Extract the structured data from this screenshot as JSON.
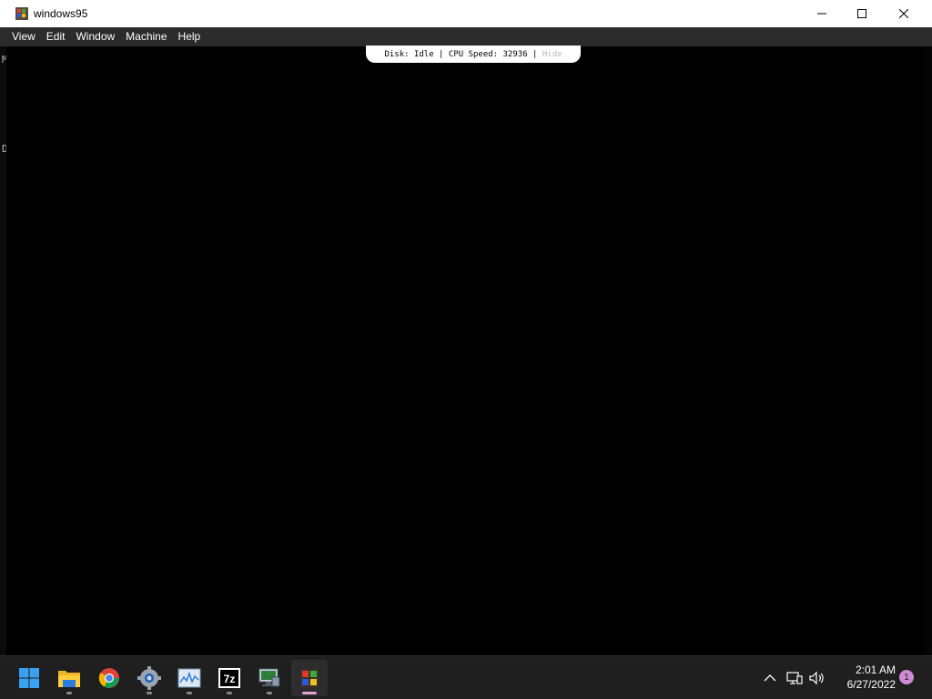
{
  "window": {
    "title": "windows95",
    "app_icon": "windows95-app-icon",
    "controls": {
      "minimize": "minimize-icon",
      "maximize": "maximize-icon",
      "close": "close-icon"
    }
  },
  "menubar": {
    "items": [
      "View",
      "Edit",
      "Window",
      "Machine",
      "Help"
    ]
  },
  "vm": {
    "edge_chars": [
      "M",
      "D"
    ],
    "status": {
      "disk_label": "Disk:",
      "disk_value": "Idle",
      "cpu_label": "CPU Speed:",
      "cpu_value": "32936",
      "hide_label": "Hide"
    }
  },
  "taskbar": {
    "apps": [
      {
        "name": "start-icon"
      },
      {
        "name": "file-explorer-icon"
      },
      {
        "name": "chrome-icon"
      },
      {
        "name": "settings-icon"
      },
      {
        "name": "task-manager-icon"
      },
      {
        "name": "7zip-icon"
      },
      {
        "name": "device-manager-icon"
      },
      {
        "name": "windows95-icon"
      }
    ],
    "tray": {
      "chevron": "chevron-up-icon",
      "network": "network-icon",
      "volume": "volume-icon"
    },
    "clock": {
      "time": "2:01 AM",
      "date": "6/27/2022"
    },
    "notification_count": "1"
  },
  "colors": {
    "titlebar": "#ffffff",
    "menubar": "#2b2b2b",
    "taskbar": "#1f1f1f",
    "screen": "#000000"
  }
}
